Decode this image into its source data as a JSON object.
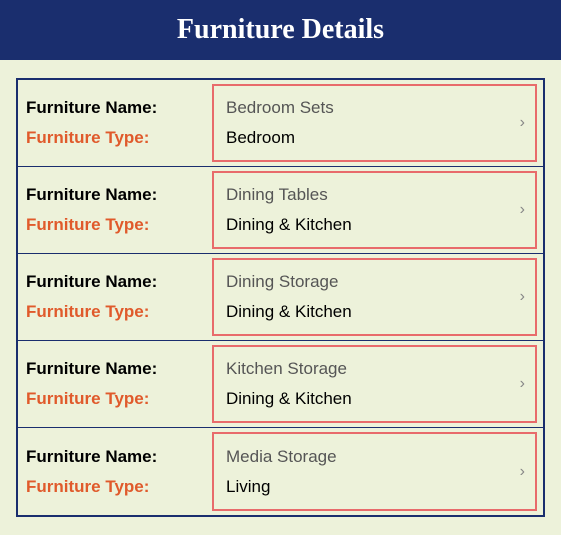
{
  "header": {
    "title": "Furniture Details"
  },
  "labels": {
    "name": "Furniture Name:",
    "type": "Furniture Type:"
  },
  "items": [
    {
      "name": "Bedroom Sets",
      "type": "Bedroom"
    },
    {
      "name": "Dining Tables",
      "type": "Dining & Kitchen"
    },
    {
      "name": "Dining Storage",
      "type": "Dining & Kitchen"
    },
    {
      "name": "Kitchen Storage",
      "type": "Dining & Kitchen"
    },
    {
      "name": "Media Storage",
      "type": "Living"
    }
  ],
  "icons": {
    "chevron": "›"
  }
}
